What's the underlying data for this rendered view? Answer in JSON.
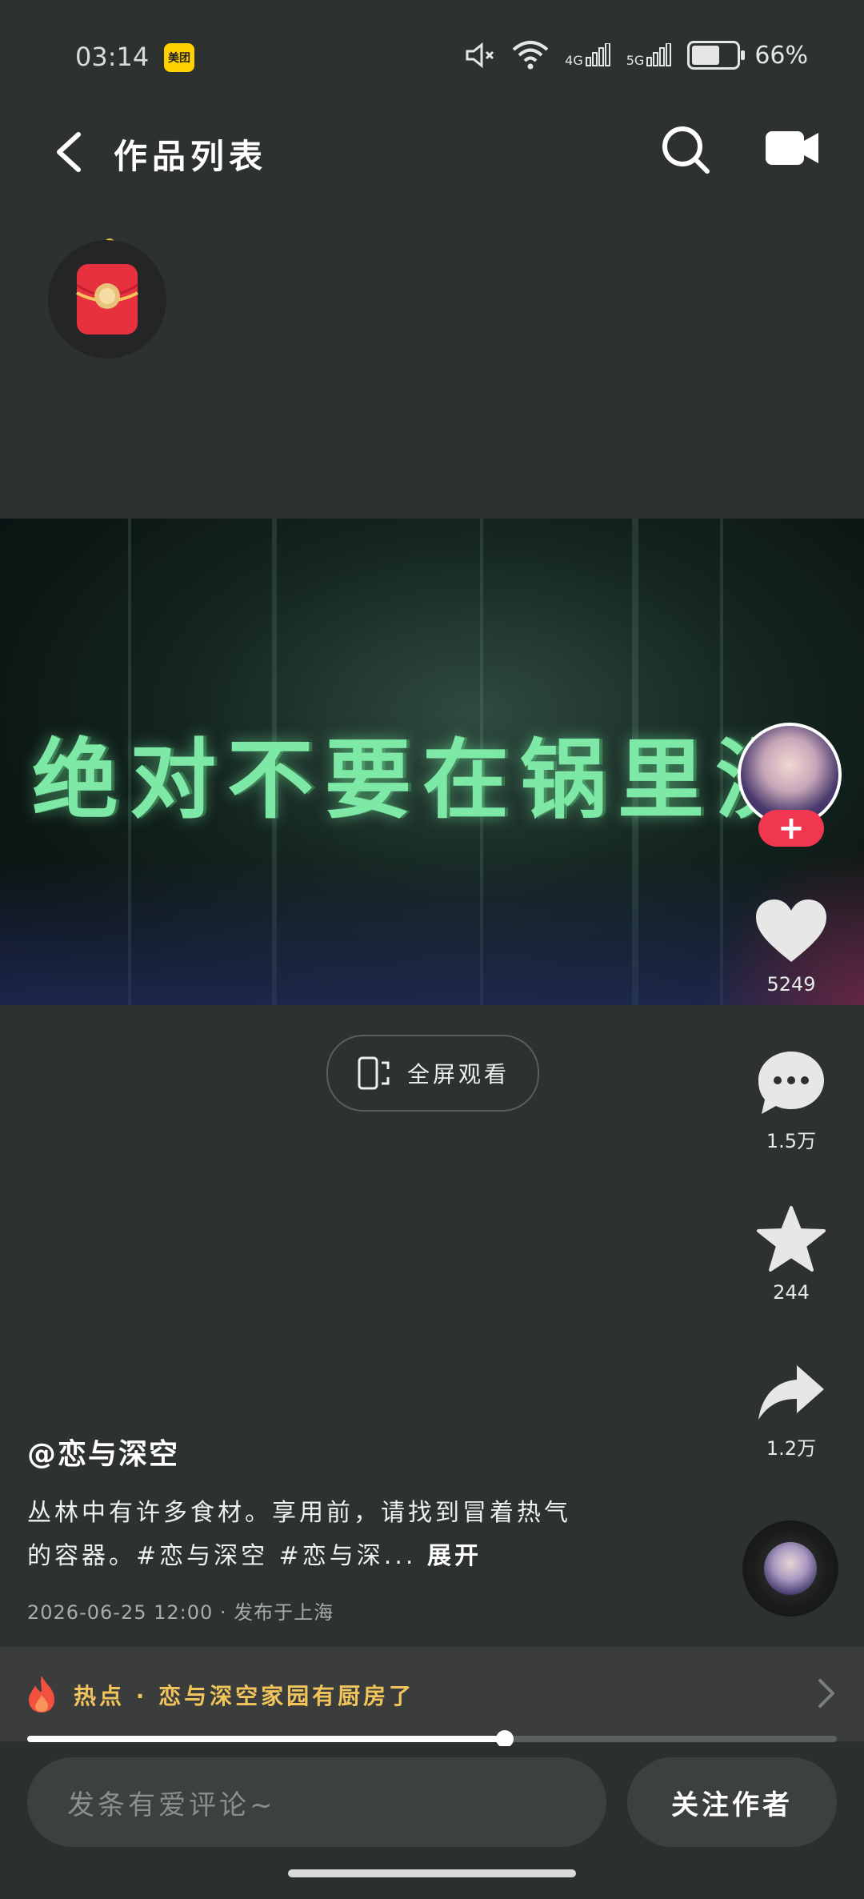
{
  "status_bar": {
    "time": "03:14",
    "app_badge": "美团",
    "signal_4g": "4G",
    "signal_5g": "5G",
    "battery_level": 0.66,
    "battery_text": "66%"
  },
  "header": {
    "title": "作品列表"
  },
  "video": {
    "caption": "绝对不要在锅里洗"
  },
  "fullscreen_button": {
    "label": "全屏观看"
  },
  "actions": {
    "likes": "5249",
    "comments": "1.5万",
    "favorites": "244",
    "shares": "1.2万",
    "follow_plus": "+"
  },
  "post": {
    "author": "@恋与深空",
    "description": "丛林中有许多食材。享用前，请找到冒着热气的容器。#恋与深空 #恋与深...",
    "expand_label": "展开",
    "meta": "2026-06-25 12:00 · 发布于上海"
  },
  "hot_topic": {
    "text": "热点 · 恋与深空家园有厨房了"
  },
  "playback": {
    "progress": 0.59
  },
  "bottom_bar": {
    "comment_placeholder": "发条有爱评论~",
    "follow_label": "关注作者"
  },
  "colors": {
    "background": "#2d312f",
    "accent_red": "#f1364f",
    "hot_topic_yellow": "#f2c45c",
    "caption_green": "#7ee8a6"
  },
  "icons": [
    "back-icon",
    "search-icon",
    "camera-icon",
    "red-envelope-icon",
    "heart-icon",
    "comment-icon",
    "star-icon",
    "share-icon",
    "flame-icon",
    "chevron-right-icon",
    "fullscreen-icon"
  ]
}
